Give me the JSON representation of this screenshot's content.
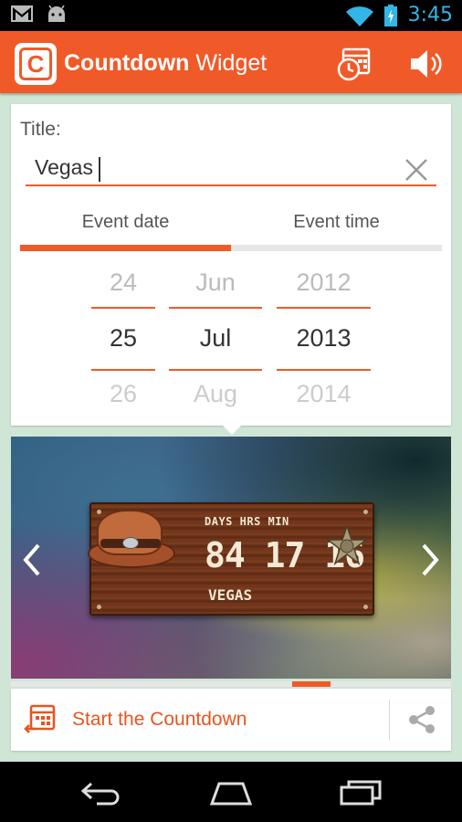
{
  "status_bar": {
    "time": "3:45",
    "icons": [
      "gmail-icon",
      "android-icon",
      "wifi-icon",
      "battery-charging-icon"
    ]
  },
  "action_bar": {
    "title_bold": "Countdown",
    "title_rest": "Widget",
    "actions": [
      "alarm-calendar-icon",
      "sound-icon"
    ]
  },
  "form": {
    "title_label": "Title:",
    "title_value": "Vegas",
    "tabs": [
      {
        "label": "Event date",
        "selected": true
      },
      {
        "label": "Event time",
        "selected": false
      }
    ]
  },
  "date_picker": {
    "day": {
      "prev": "24",
      "current": "25",
      "next": "26"
    },
    "month": {
      "prev": "Jun",
      "current": "Jul",
      "next": "Aug"
    },
    "year": {
      "prev": "2012",
      "current": "2013",
      "next": "2014"
    }
  },
  "preview": {
    "widget": {
      "labels": "DAYS HRS  MIN",
      "numbers": "84 17 16",
      "name": "VEGAS",
      "theme": "wild-west"
    },
    "page_index": 6,
    "page_count": 8
  },
  "bottom_bar": {
    "start_label": "Start the Countdown"
  },
  "colors": {
    "accent": "#f05a28",
    "background": "#cfe6d6",
    "status_clock": "#33b5e5"
  }
}
